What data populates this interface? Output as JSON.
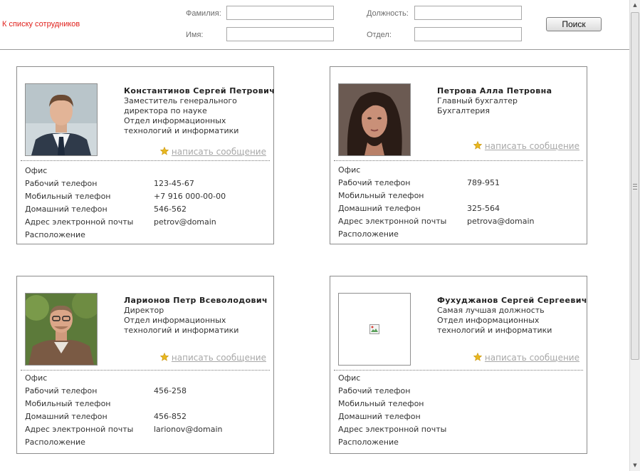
{
  "header": {
    "back_link": "К списку сотрудников",
    "search_button": "Поиск",
    "fields": {
      "surname": {
        "label": "Фамилия:",
        "value": ""
      },
      "name": {
        "label": "Имя:",
        "value": ""
      },
      "position": {
        "label": "Должность:",
        "value": ""
      },
      "department": {
        "label": "Отдел:",
        "value": ""
      }
    }
  },
  "labels": {
    "send_message": "написать сообщение",
    "office": "Офис",
    "work_phone": "Рабочий телефон",
    "mobile_phone": "Мобильный телефон",
    "home_phone": "Домашний телефон",
    "email": "Адрес электронной почты",
    "location": "Расположение"
  },
  "employees": [
    {
      "name": "Константинов Сергей Петрович",
      "position": "Заместитель генерального директора по науке",
      "department": "Отдел информационных технологий и информатики",
      "office": "",
      "work_phone": "123-45-67",
      "mobile_phone": "+7 916 000-00-00",
      "home_phone": "546-562",
      "email": "petrov@domain",
      "location": "",
      "photo": "man-suit-photo"
    },
    {
      "name": "Петрова Алла Петровна",
      "position": "Главный бухгалтер",
      "department": "Бухгалтерия",
      "office": "",
      "work_phone": "789-951",
      "mobile_phone": "",
      "home_phone": "325-564",
      "email": "petrova@domain",
      "location": "",
      "photo": "woman-photo"
    },
    {
      "name": "Ларионов Петр Всеволодович",
      "position": "Директор",
      "department": "Отдел информационных технологий и информатики",
      "office": "",
      "work_phone": "456-258",
      "mobile_phone": "",
      "home_phone": "456-852",
      "email": "larionov@domain",
      "location": "",
      "photo": "man-glasses-photo"
    },
    {
      "name": "Фухуджанов Сергей Сергеевич",
      "position": "Самая лучшая должность",
      "department": "Отдел информационных технологий и информатики",
      "office": "",
      "work_phone": "",
      "mobile_phone": "",
      "home_phone": "",
      "email": "",
      "location": "",
      "photo": "broken-image-icon"
    }
  ],
  "colors": {
    "link": "#e0201c",
    "muted_link": "#a8a8a8",
    "star": "#e8b820"
  }
}
